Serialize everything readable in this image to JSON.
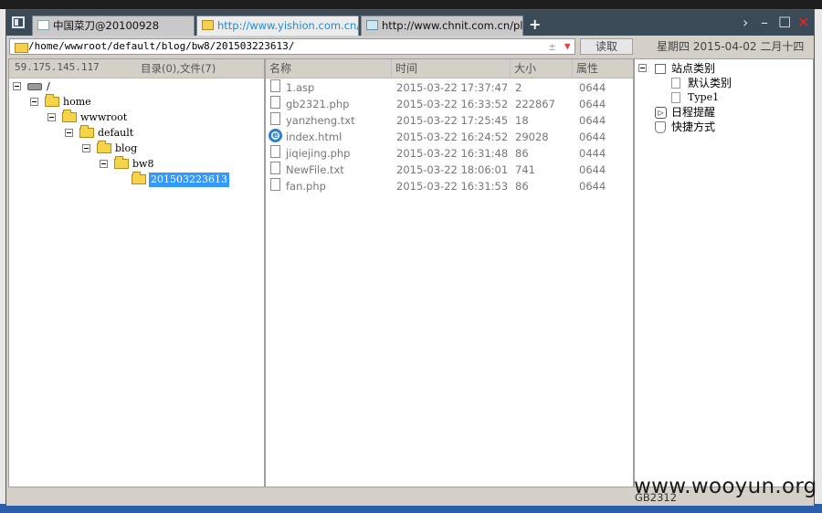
{
  "window": {
    "tabs": [
      {
        "label": "中国菜刀@20100928",
        "active": false
      },
      {
        "label": "http://www.yishion.com.cn/bl...",
        "active": true
      },
      {
        "label": "http://www.chnit.com.cn/plu...",
        "active": false
      }
    ],
    "controls": {
      "add": "+",
      "next": "›",
      "minimize": "–",
      "maximize": "☐",
      "close": "✕"
    }
  },
  "address_bar": {
    "path": "/home/wwwroot/default/blog/bw8/201503223613/",
    "plusminus": "±",
    "dropdown": "▼",
    "read_button": "读取",
    "date": "星期四 2015-04-02 二月十四"
  },
  "tree": {
    "ip": "59.175.145.117",
    "summary": "目录(0),文件(7)",
    "nodes": [
      {
        "label": "/",
        "depth": 0,
        "type": "drive"
      },
      {
        "label": "home",
        "depth": 1,
        "type": "folder"
      },
      {
        "label": "wwwroot",
        "depth": 2,
        "type": "folder"
      },
      {
        "label": "default",
        "depth": 3,
        "type": "folder"
      },
      {
        "label": "blog",
        "depth": 4,
        "type": "folder"
      },
      {
        "label": "bw8",
        "depth": 5,
        "type": "folder"
      },
      {
        "label": "201503223613",
        "depth": 6,
        "type": "folder",
        "selected": true
      }
    ]
  },
  "file_list": {
    "columns": [
      "名称",
      "时间",
      "大小",
      "属性"
    ],
    "rows": [
      {
        "name": "1.asp",
        "time": "2015-03-22 17:37:47",
        "size": "2",
        "attr": "0644",
        "icon": "document-icon"
      },
      {
        "name": "gb2321.php",
        "time": "2015-03-22 16:33:52",
        "size": "222867",
        "attr": "0644",
        "icon": "document-icon"
      },
      {
        "name": "yanzheng.txt",
        "time": "2015-03-22 17:25:45",
        "size": "18",
        "attr": "0644",
        "icon": "document-icon"
      },
      {
        "name": "index.html",
        "time": "2015-03-22 16:24:52",
        "size": "29028",
        "attr": "0644",
        "icon": "ie-icon"
      },
      {
        "name": "jiqiejing.php",
        "time": "2015-03-22 16:31:48",
        "size": "86",
        "attr": "0444",
        "icon": "document-icon"
      },
      {
        "name": "NewFile.txt",
        "time": "2015-03-22 18:06:01",
        "size": "741",
        "attr": "0644",
        "icon": "document-icon"
      },
      {
        "name": "fan.php",
        "time": "2015-03-22 16:31:53",
        "size": "86",
        "attr": "0644",
        "icon": "document-icon"
      }
    ]
  },
  "categories": {
    "root": "站点类别",
    "children": [
      "默认类别",
      "Type1"
    ],
    "schedule": "日程提醒",
    "shortcut": "快捷方式"
  },
  "status": {
    "encoding": "GB2312"
  },
  "watermark": "www.wooyun.org"
}
